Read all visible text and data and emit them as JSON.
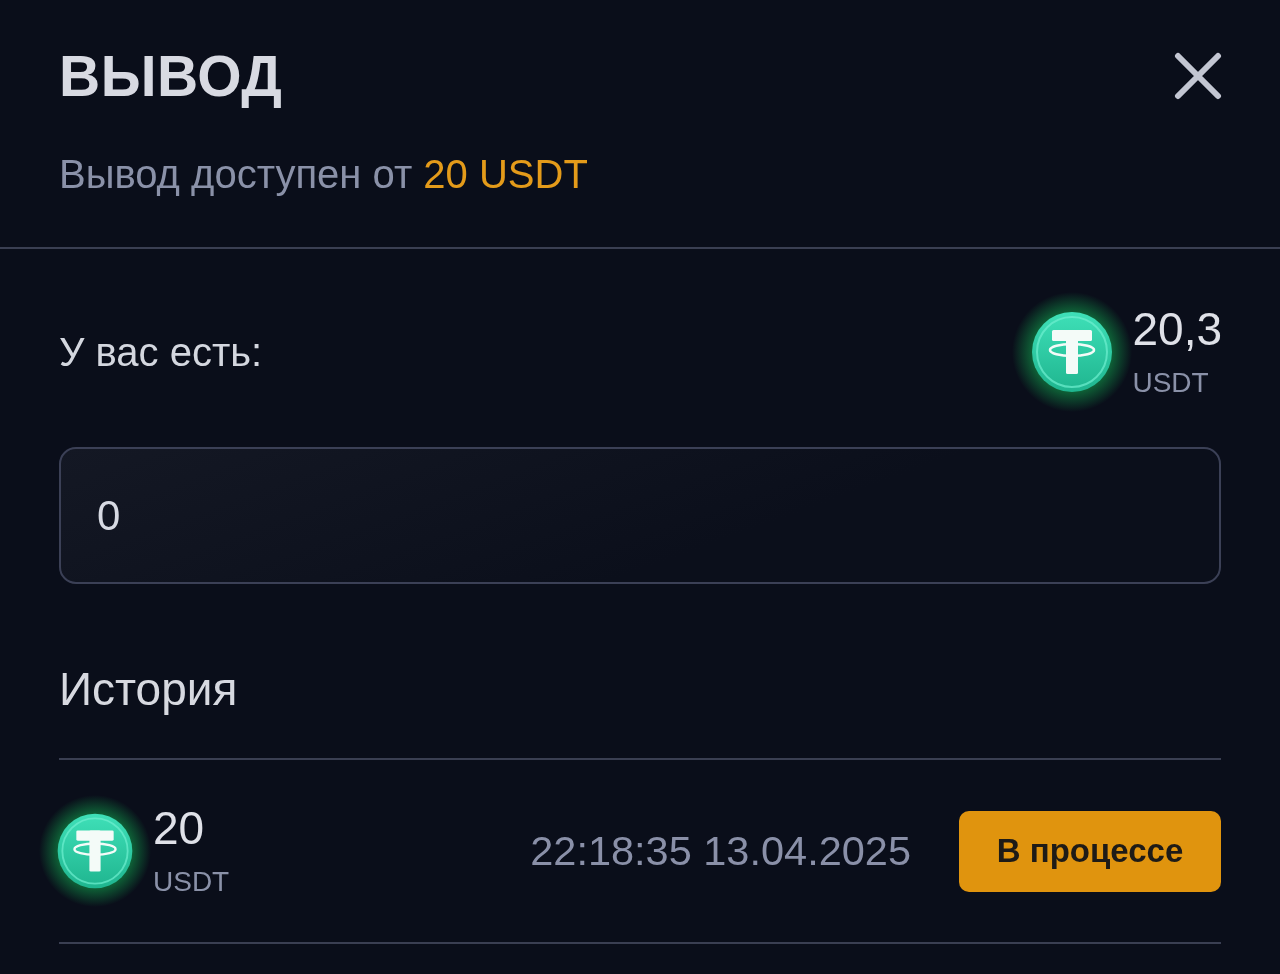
{
  "dialog": {
    "title": "ВЫВОД",
    "subtitle": {
      "text": "Вывод доступен от",
      "highlight": "20 USDT"
    }
  },
  "balance": {
    "label": "У вас есть:",
    "amount": "20,3",
    "currency": "USDT"
  },
  "amount_field": {
    "value": "0"
  },
  "history": {
    "title": "История",
    "entries": [
      {
        "amount": "20",
        "currency": "USDT",
        "time": "22:18:35 13.04.2025",
        "status": {
          "label": "В процессе",
          "kind": "pending"
        }
      }
    ]
  }
}
